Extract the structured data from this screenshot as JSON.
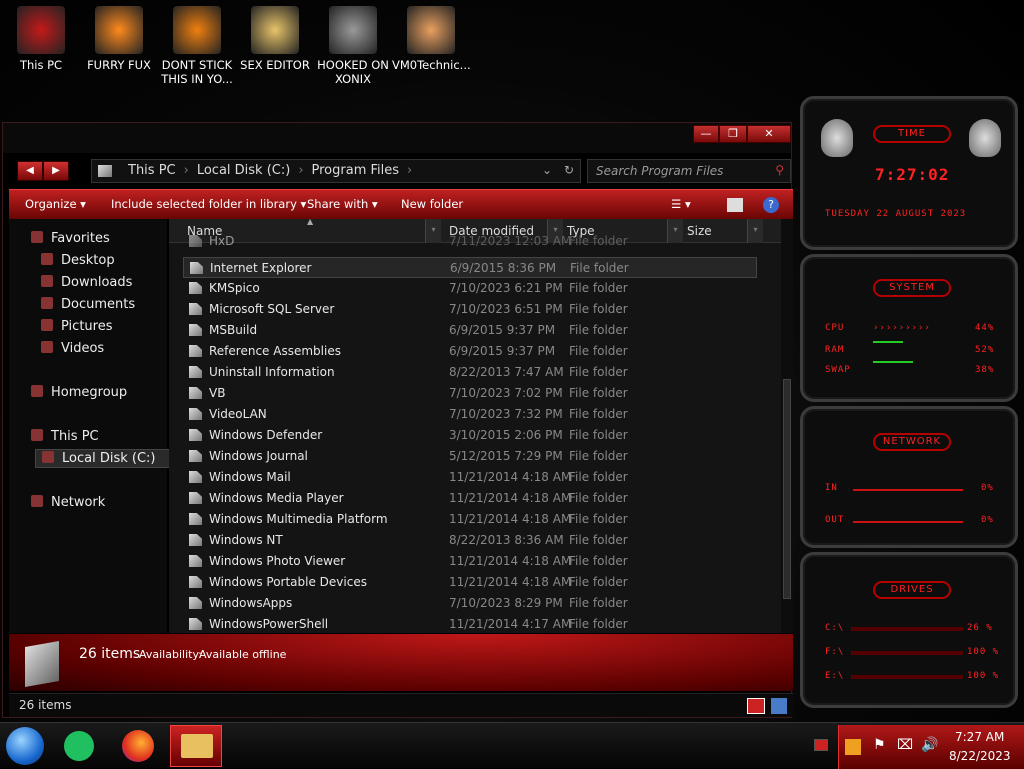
{
  "desktop": {
    "icons": [
      {
        "label": "This PC",
        "icon": "monitor-icon",
        "color": "#c41a1a"
      },
      {
        "label": "FURRY FUX",
        "icon": "firefox-icon",
        "color": "#ff8a1e"
      },
      {
        "label": "DONT STICK\nTHIS IN YO...",
        "icon": "vlc-cone-icon",
        "color": "#f08010"
      },
      {
        "label": "SEX EDITOR",
        "icon": "hxd-icon",
        "color": "#e8c46a"
      },
      {
        "label": "HOOKED ON\nXONIX",
        "icon": "game-icon",
        "color": "#9a9a9a"
      },
      {
        "label": "VM0Technic...",
        "icon": "user-doctor-icon",
        "color": "#e8a060"
      }
    ]
  },
  "window": {
    "controls": {
      "minimize": "—",
      "maximize": "❐",
      "close": "✕"
    },
    "nav": {
      "back": "◀",
      "forward": "▶"
    },
    "breadcrumb": [
      "This PC",
      "Local Disk (C:)",
      "Program Files"
    ],
    "search_placeholder": "Search Program Files",
    "commands": {
      "organize": "Organize",
      "include": "Include selected folder in library",
      "share": "Share with",
      "new_folder": "New folder"
    },
    "sidebar": {
      "favorites": "Favorites",
      "favorites_items": [
        "Desktop",
        "Downloads",
        "Documents",
        "Pictures",
        "Videos"
      ],
      "homegroup": "Homegroup",
      "this_pc": "This PC",
      "local_disk": "Local Disk (C:)",
      "network": "Network"
    },
    "columns": [
      "Name",
      "Date modified",
      "Type",
      "Size"
    ],
    "files": [
      {
        "name": "HxD",
        "date": "7/11/2023 12:03 AM",
        "type": "File folder"
      },
      {
        "name": "Internet Explorer",
        "date": "6/9/2015 8:36 PM",
        "type": "File folder",
        "selected": true
      },
      {
        "name": "KMSpico",
        "date": "7/10/2023 6:21 PM",
        "type": "File folder"
      },
      {
        "name": "Microsoft SQL Server",
        "date": "7/10/2023 6:51 PM",
        "type": "File folder"
      },
      {
        "name": "MSBuild",
        "date": "6/9/2015 9:37 PM",
        "type": "File folder"
      },
      {
        "name": "Reference Assemblies",
        "date": "6/9/2015 9:37 PM",
        "type": "File folder"
      },
      {
        "name": "Uninstall Information",
        "date": "8/22/2013 7:47 AM",
        "type": "File folder"
      },
      {
        "name": "VB",
        "date": "7/10/2023 7:02 PM",
        "type": "File folder"
      },
      {
        "name": "VideoLAN",
        "date": "7/10/2023 7:32 PM",
        "type": "File folder"
      },
      {
        "name": "Windows Defender",
        "date": "3/10/2015 2:06 PM",
        "type": "File folder"
      },
      {
        "name": "Windows Journal",
        "date": "5/12/2015 7:29 PM",
        "type": "File folder"
      },
      {
        "name": "Windows Mail",
        "date": "11/21/2014 4:18 AM",
        "type": "File folder"
      },
      {
        "name": "Windows Media Player",
        "date": "11/21/2014 4:18 AM",
        "type": "File folder"
      },
      {
        "name": "Windows Multimedia Platform",
        "date": "11/21/2014 4:18 AM",
        "type": "File folder"
      },
      {
        "name": "Windows NT",
        "date": "8/22/2013 8:36 AM",
        "type": "File folder"
      },
      {
        "name": "Windows Photo Viewer",
        "date": "11/21/2014 4:18 AM",
        "type": "File folder"
      },
      {
        "name": "Windows Portable Devices",
        "date": "11/21/2014 4:18 AM",
        "type": "File folder"
      },
      {
        "name": "WindowsApps",
        "date": "7/10/2023 8:29 PM",
        "type": "File folder"
      },
      {
        "name": "WindowsPowerShell",
        "date": "11/21/2014 4:17 AM",
        "type": "File folder"
      }
    ],
    "details": {
      "count": "26 items",
      "availability_label": "Availability:",
      "availability_value": "Available offline"
    },
    "status": "26 items"
  },
  "gadget": {
    "time_title": "TIME",
    "time": "7:27:02",
    "date": "TUESDAY 22 AUGUST 2023",
    "system_title": "SYSTEM",
    "cpu_label": "CPU",
    "cpu_value": "44%",
    "ram_label": "RAM",
    "ram_value": "52%",
    "swap_label": "SWAP",
    "swap_value": "38%",
    "network_title": "NETWORK",
    "in_label": "IN",
    "in_value": "0%",
    "out_label": "OUT",
    "out_value": "0%",
    "drives_title": "DRIVES",
    "drives": [
      {
        "label": "C:\\",
        "value": "26 %"
      },
      {
        "label": "F:\\",
        "value": "100 %"
      },
      {
        "label": "E:\\",
        "value": "100 %"
      }
    ]
  },
  "taskbar": {
    "apps": [
      "start-orb-icon",
      "chat-app-icon",
      "firefox-icon",
      "file-explorer-icon"
    ],
    "clock_time": "7:27 AM",
    "clock_date": "8/22/2023"
  },
  "colors": {
    "accent": "#c41a1a",
    "accent_dark": "#6a0505",
    "gadget_red": "#ff2020"
  }
}
